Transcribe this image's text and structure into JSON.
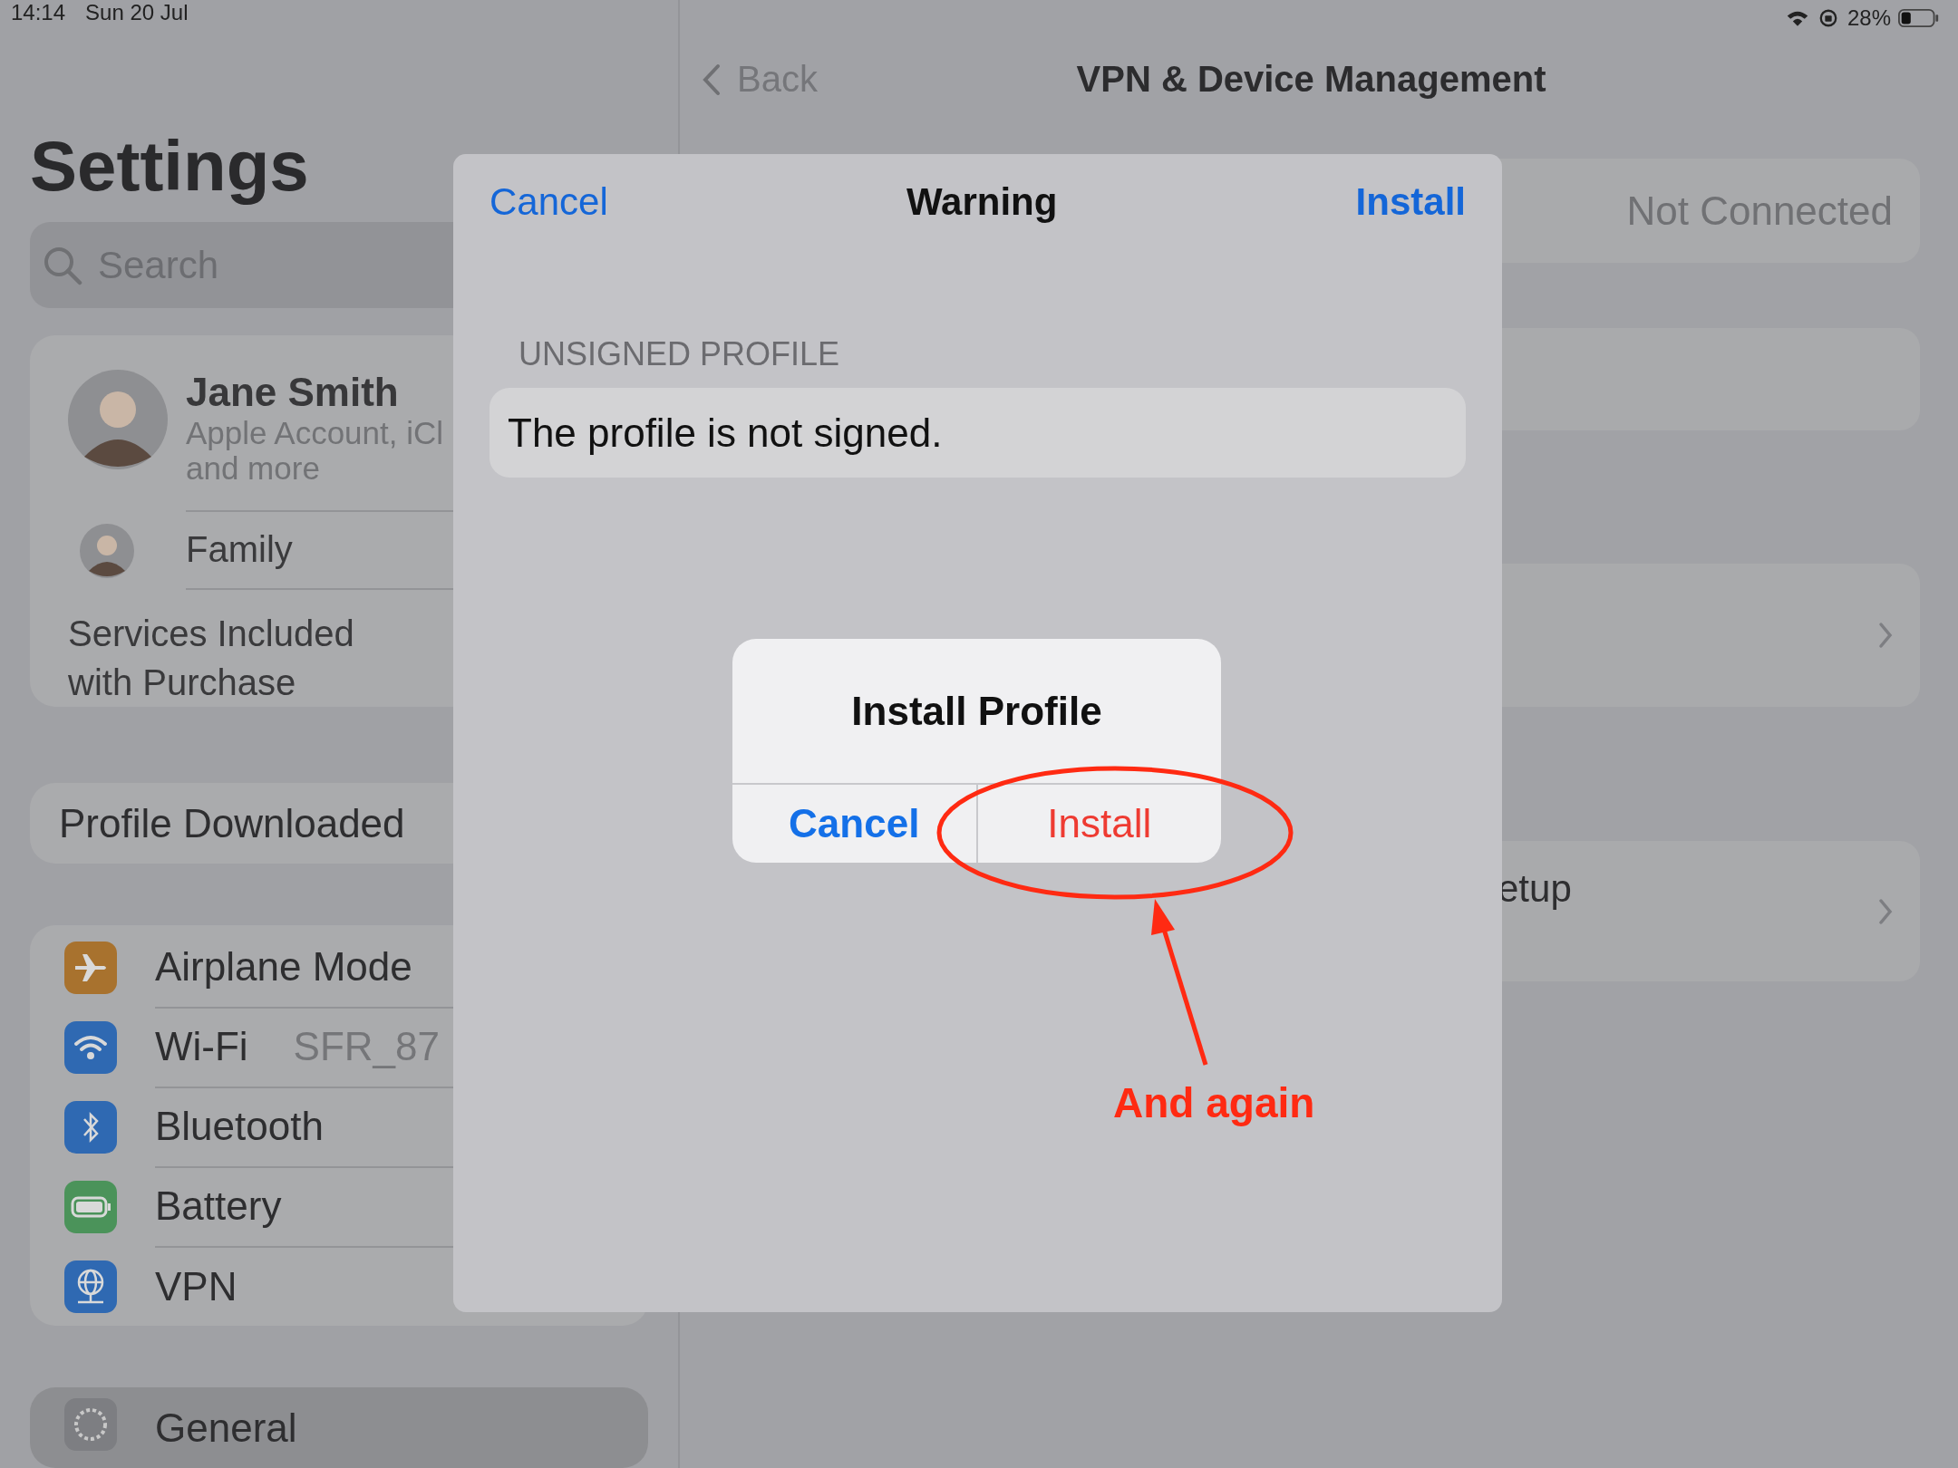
{
  "status_bar": {
    "time": "14:14",
    "date": "Sun 20 Jul",
    "battery_percent": "28%"
  },
  "sidebar": {
    "title": "Settings",
    "search": {
      "placeholder": "Search"
    },
    "account": {
      "name": "Jane Smith",
      "subtitle_lines": [
        "Apple Account, iCl",
        "and more"
      ]
    },
    "family_label": "Family",
    "services_label": "Services Included with Purchase",
    "profile_downloaded": "Profile Downloaded",
    "items": [
      {
        "kind": "airplane",
        "label": "Airplane Mode",
        "color": "#a8722e"
      },
      {
        "kind": "wifi",
        "label": "Wi-Fi",
        "value": "SFR_87",
        "color": "#2f69b2"
      },
      {
        "kind": "bluetooth",
        "label": "Bluetooth",
        "color": "#2f69b2"
      },
      {
        "kind": "battery",
        "label": "Battery",
        "color": "#4b935a"
      },
      {
        "kind": "vpn",
        "label": "VPN",
        "color": "#2f69b2"
      }
    ],
    "general": {
      "kind": "gear",
      "label": "General",
      "color": "#7d7e82"
    }
  },
  "detail": {
    "back_label": "Back",
    "title": "VPN & Device Management",
    "rows": [
      {
        "kind": "value",
        "value": "Not Connected"
      },
      {
        "kind": "blank"
      },
      {
        "kind": "link"
      },
      {
        "kind": "link",
        "label": "etup"
      }
    ]
  },
  "modal": {
    "cancel": "Cancel",
    "title": "Warning",
    "install": "Install",
    "section_header": "UNSIGNED PROFILE",
    "message": "The profile is not signed.",
    "alert": {
      "title": "Install Profile",
      "cancel": "Cancel",
      "install": "Install"
    }
  },
  "annotation": {
    "text": "And again"
  }
}
